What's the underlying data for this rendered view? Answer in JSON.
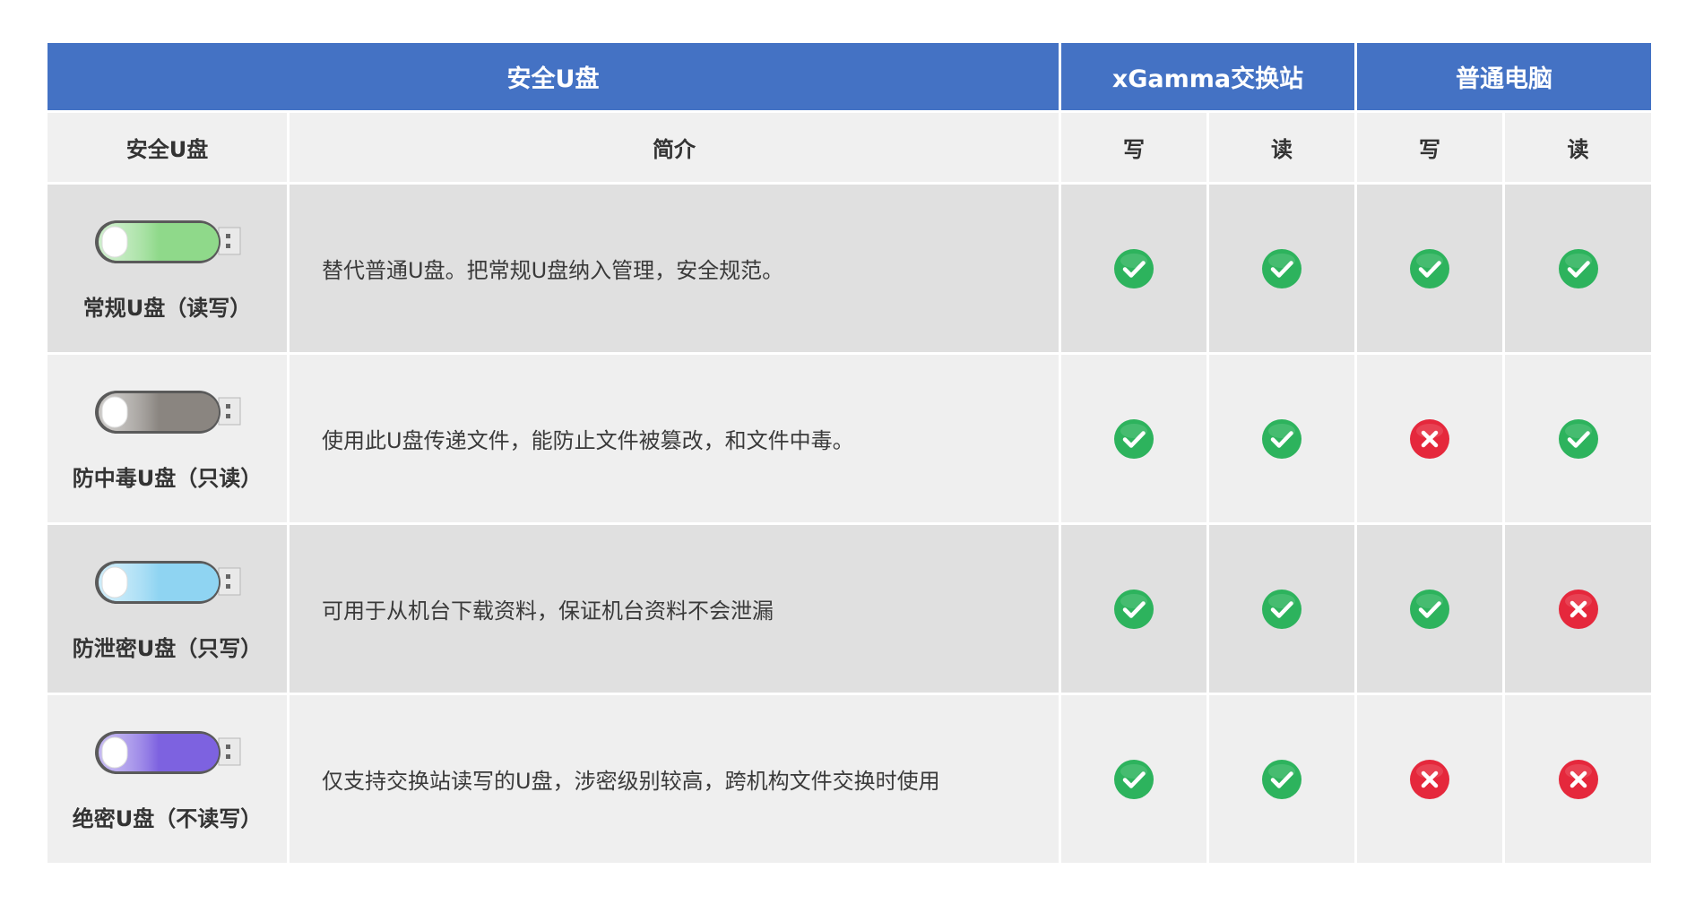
{
  "table": {
    "group_headers": {
      "usb": "安全U盘",
      "xgamma": "xGamma交换站",
      "pc": "普通电脑"
    },
    "col_headers": {
      "usb": "安全U盘",
      "desc": "简介",
      "xg_write": "写",
      "xg_read": "读",
      "pc_write": "写",
      "pc_read": "读"
    },
    "rows": [
      {
        "name": "常规U盘（读写）",
        "desc": "替代普通U盘。把常规U盘纳入管理，安全规范。",
        "usb_color": "#8fd98a",
        "xg_write": true,
        "xg_read": true,
        "pc_write": true,
        "pc_read": true
      },
      {
        "name": "防中毒U盘（只读）",
        "desc": "使用此U盘传递文件，能防止文件被篡改，和文件中毒。",
        "usb_color": "#8a8580",
        "xg_write": true,
        "xg_read": true,
        "pc_write": false,
        "pc_read": true
      },
      {
        "name": "防泄密U盘（只写）",
        "desc": "可用于从机台下载资料，保证机台资料不会泄漏",
        "usb_color": "#8fd4f2",
        "xg_write": true,
        "xg_read": true,
        "pc_write": true,
        "pc_read": false
      },
      {
        "name": "绝密U盘（不读写）",
        "desc": "仅支持交换站读写的U盘，涉密级别较高，跨机构文件交换时使用",
        "usb_color": "#7d62e0",
        "xg_write": true,
        "xg_read": true,
        "pc_write": false,
        "pc_read": false
      }
    ]
  },
  "colors": {
    "header_blue": "#4472c4",
    "check_green": "#2db35d",
    "cross_red": "#e5283c"
  }
}
